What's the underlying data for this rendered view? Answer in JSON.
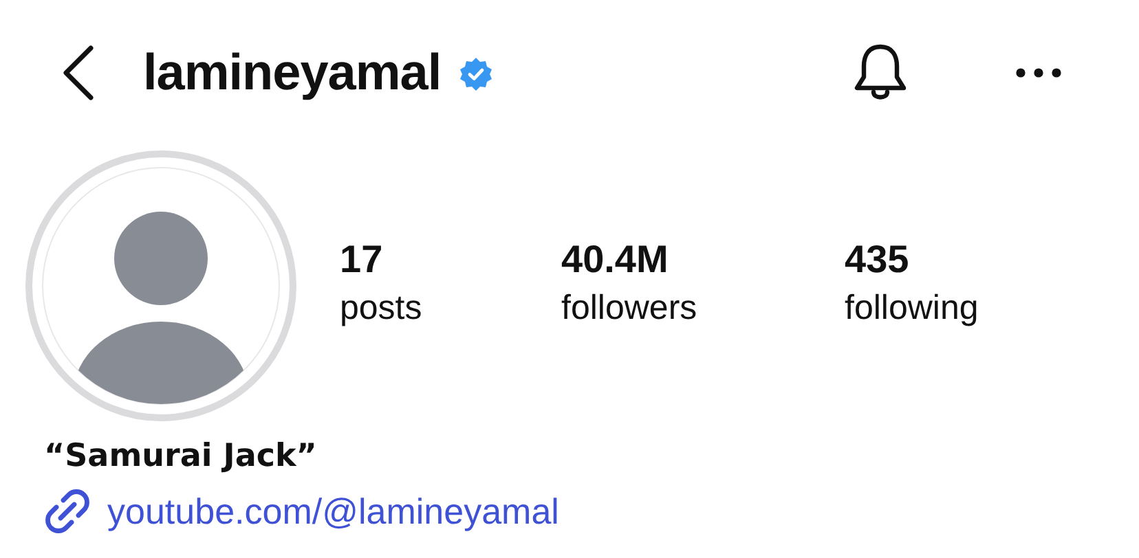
{
  "header": {
    "username": "lamineyamal",
    "verified": true
  },
  "stats": [
    {
      "value": "17",
      "label": "posts"
    },
    {
      "value": "40.4M",
      "label": "followers"
    },
    {
      "value": "435",
      "label": "following"
    }
  ],
  "bio": {
    "name": "“Samurai Jack”",
    "link": "youtube.com/@lamineyamal"
  }
}
